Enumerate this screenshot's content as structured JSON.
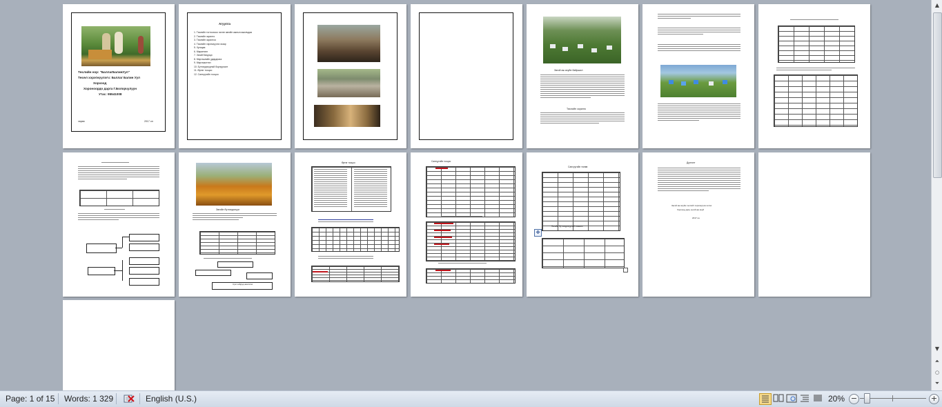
{
  "document": {
    "cover": {
      "title_line": "Төслийн нэр: \"БаллагБалинУул\"",
      "organization_line": "Төсөл хэрэгжүүлэгч: Баллаг Балин Уул",
      "place_line1": "Хорхоод",
      "place_line2": "Хороноордо дарга Г.Болорчулуун",
      "phone_line": "Утас: 95541008",
      "footer_left": "хөрөө",
      "footer_right": "2017 он"
    },
    "toc": {
      "heading": "Агуулга",
      "items": [
        "Төслийн тогтоохоос эхлэн зөгийн ажлын ажилчдаа",
        "Төслийн зорилго",
        "Төслийн зорилгоо",
        "Төслийн хэрэгжүүлэх газар",
        "Хугацаа",
        "Маркетинг",
        "Зөгий бэлдэцэ",
        "Мэргэжлийн удирдлага",
        "Мэргэжилтэн",
        "Бүтээгдэхүүний борлуулалт",
        "Өртөг тооцоо",
        "Санхүүгийн тооцоо"
      ]
    },
    "page2_heading": "Зөгий аж ахуйн байршил",
    "page2_subheading": "Төслийн зорилго",
    "page9_heading": "Зөгийн бүтээгдэхүүн",
    "page9_caption": "Сүм хийдэд ажиллах",
    "page10_heading": "Өртөг тооцоо",
    "page11_heading": "Санхүүгийн тооцоо",
    "page12_heading": "Санхүүгийн төлөв",
    "page12_caption": "Зөгийн бүтээгдэхүүний хэмжээ",
    "page13_heading": "Дүгнэлт",
    "page13_note1": "Зөгий аж ахуйн төслийг хэрэгжүүлж эхлэх",
    "page13_note2": "Хорхоод дахь зөгий аж ахуй",
    "page13_note3": "2017 он"
  },
  "status_bar": {
    "page": "Page: 1 of 15",
    "words": "Words: 1 329",
    "language": "English (U.S.)",
    "zoom": "20%",
    "zoom_fraction": 0.2
  },
  "colors": {
    "workspace": "#a8b0bb",
    "statusbar": "#dce4ee",
    "table_accent": "#c0141b"
  }
}
